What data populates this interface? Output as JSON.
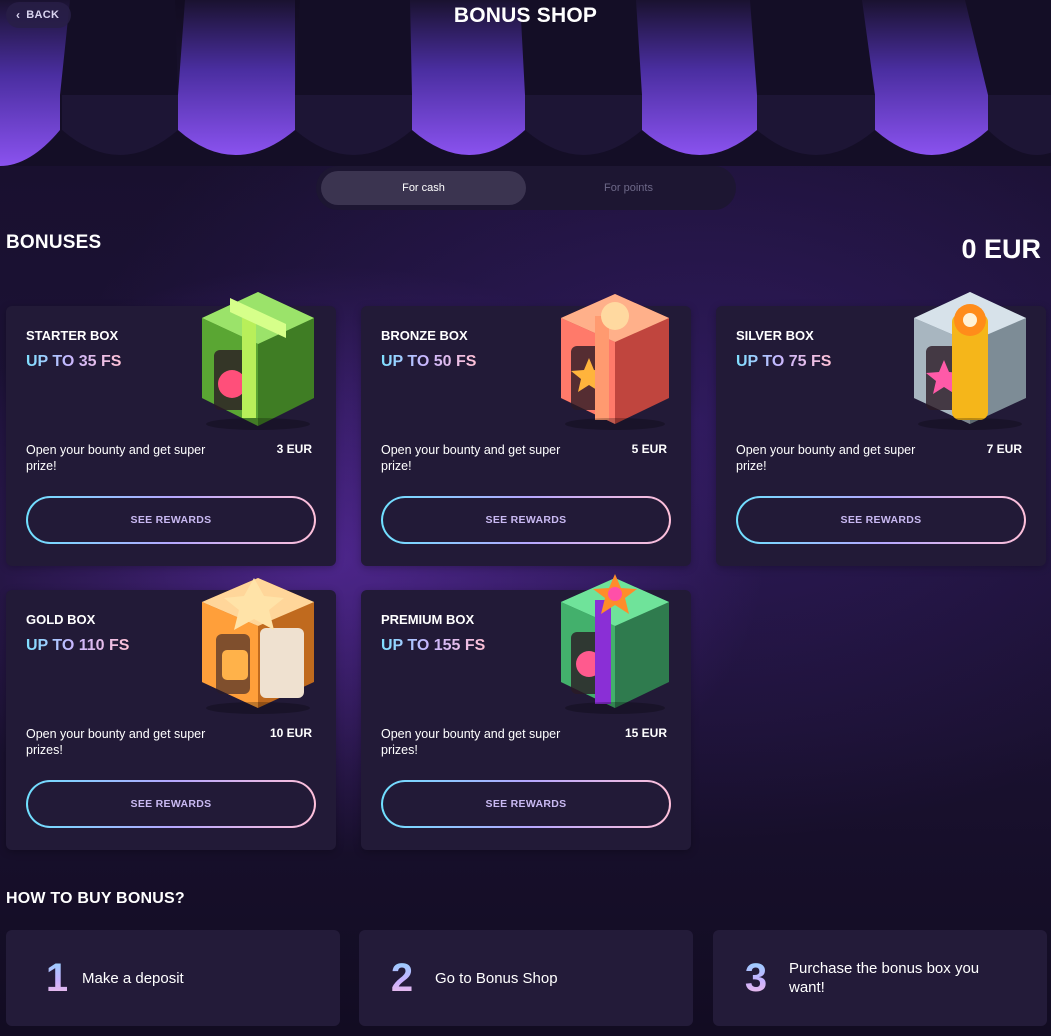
{
  "header": {
    "back_label": "BACK",
    "title": "BONUS SHOP"
  },
  "toggle": {
    "options": [
      {
        "label": "For cash",
        "active": true
      },
      {
        "label": "For points",
        "active": false
      }
    ]
  },
  "bonuses": {
    "title": "BONUSES",
    "balance": "0 EUR",
    "cards": [
      {
        "name": "STARTER BOX",
        "fs": "UP TO 35 FS",
        "desc": "Open your bounty and get super prize!",
        "price": "3 EUR",
        "button": "SEE REWARDS",
        "box_color": "green"
      },
      {
        "name": "BRONZE BOX",
        "fs": "UP TO 50 FS",
        "desc": "Open your bounty and get super prize!",
        "price": "5 EUR",
        "button": "SEE REWARDS",
        "box_color": "coral"
      },
      {
        "name": "SILVER BOX",
        "fs": "UP TO 75 FS",
        "desc": "Open your bounty and get super prize!",
        "price": "7 EUR",
        "button": "SEE REWARDS",
        "box_color": "silver"
      },
      {
        "name": "GOLD BOX",
        "fs": "UP TO 110 FS",
        "desc": "Open your bounty and get super prizes!",
        "price": "10 EUR",
        "button": "SEE REWARDS",
        "box_color": "gold"
      },
      {
        "name": "PREMIUM BOX",
        "fs": "UP TO 155 FS",
        "desc": "Open your bounty and get super prizes!",
        "price": "15 EUR",
        "button": "SEE REWARDS",
        "box_color": "emerald"
      }
    ]
  },
  "how_to": {
    "title": "HOW TO BUY BONUS?",
    "steps": [
      {
        "num": "1",
        "text": "Make a deposit"
      },
      {
        "num": "2",
        "text": "Go to Bonus Shop"
      },
      {
        "num": "3",
        "text": "Purchase the bonus box you want!"
      }
    ]
  },
  "colors": {
    "accent_cyan": "#6fe0ff",
    "accent_lilac": "#b5a7ff",
    "accent_pink": "#ffc0da",
    "card_bg": "#221a37",
    "awning_purple": "#7b3fe0"
  }
}
